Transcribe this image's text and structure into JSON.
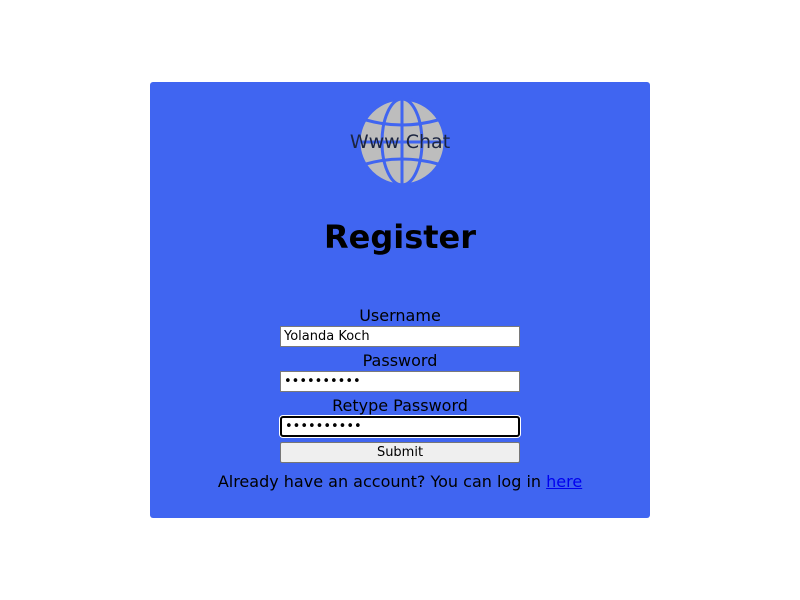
{
  "logo": {
    "text": "Www Chat",
    "icon": "globe-icon",
    "icon_color": "#bdbdbd",
    "icon_line_color": "#4065f1"
  },
  "form": {
    "title": "Register",
    "fields": [
      {
        "label": "Username",
        "value": "Yolanda Koch",
        "type": "text"
      },
      {
        "label": "Password",
        "value": "••••••••••",
        "type": "password"
      },
      {
        "label": "Retype Password",
        "value": "••••••••••",
        "type": "password",
        "focused": true
      }
    ],
    "submit_label": "Submit"
  },
  "footer": {
    "prompt": "Already have an account? You can log in ",
    "link_text": "here"
  },
  "colors": {
    "card_background": "#4065f1",
    "link": "#0000ee"
  }
}
